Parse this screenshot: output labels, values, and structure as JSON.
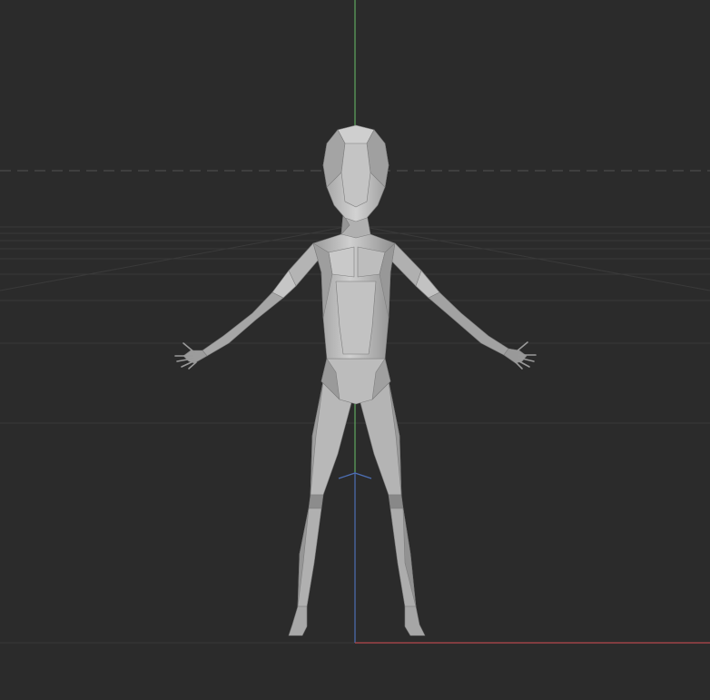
{
  "viewport": {
    "mode": "3d-viewport",
    "shading": "solid",
    "projection": "front-orthographic"
  },
  "colors": {
    "background": "#2b2b2b",
    "grid_line": "#3b3b3b",
    "grid_line_dashed": "#4a4a4a",
    "axis_y": "#5fa85f",
    "axis_z": "#4d6fb5",
    "axis_x": "#b5484d",
    "mesh_light": "#c8c8c8",
    "mesh_mid": "#a8a8a8",
    "mesh_dark": "#8c8c8c",
    "mesh_shadow": "#767676"
  },
  "scene": {
    "object": "low-poly-humanoid-mesh",
    "pose": "a-pose"
  }
}
